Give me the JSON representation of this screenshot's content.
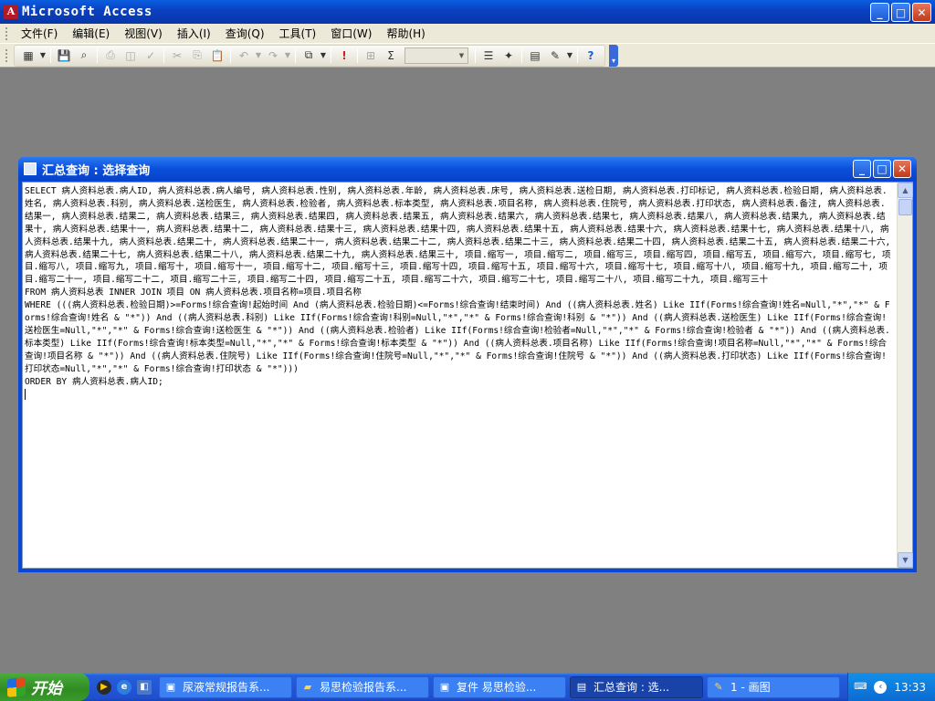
{
  "app": {
    "title": "Microsoft Access",
    "icon": "access-icon",
    "controls": {
      "minimize": "_",
      "maximize": "□",
      "close": "✕"
    }
  },
  "menu": [
    "文件(F)",
    "编辑(E)",
    "视图(V)",
    "插入(I)",
    "查询(Q)",
    "工具(T)",
    "窗口(W)",
    "帮助(H)"
  ],
  "toolbar": {
    "items": [
      "view-icon",
      "save-icon",
      "print-preview-icon",
      "print-icon",
      "spelling-icon",
      "cut-icon",
      "copy-icon",
      "paste-icon",
      "undo-icon",
      "redo-icon",
      "query-type-icon",
      "run-icon",
      "show-table-icon",
      "totals-icon",
      "properties-icon",
      "build-icon",
      "database-window-icon",
      "new-object-icon",
      "help-icon"
    ],
    "run_glyph": "!",
    "totals_glyph": "Σ",
    "help_glyph": "?",
    "zoom_value": ""
  },
  "query_window": {
    "title": "汇总查询 : 选择查询",
    "sql_lines": [
      "SELECT 病人资料总表.病人ID, 病人资料总表.病人编号, 病人资料总表.性别, 病人资料总表.年龄, 病人资料总表.床号, 病人资料总表.送检日期, 病人资料总表.打印标记, 病人资料总表.检验日期, 病人资料总表.姓名, 病人资料总表.科别, 病人资料总表.送检医生, 病人资料总表.检验者, 病人资料总表.标本类型, 病人资料总表.项目名称, 病人资料总表.住院号, 病人资料总表.打印状态, 病人资料总表.备注, 病人资料总表.结果一, 病人资料总表.结果二, 病人资料总表.结果三, 病人资料总表.结果四, 病人资料总表.结果五, 病人资料总表.结果六, 病人资料总表.结果七, 病人资料总表.结果八, 病人资料总表.结果九, 病人资料总表.结果十, 病人资料总表.结果十一, 病人资料总表.结果十二, 病人资料总表.结果十三, 病人资料总表.结果十四, 病人资料总表.结果十五, 病人资料总表.结果十六, 病人资料总表.结果十七, 病人资料总表.结果十八, 病人资料总表.结果十九, 病人资料总表.结果二十, 病人资料总表.结果二十一, 病人资料总表.结果二十二, 病人资料总表.结果二十三, 病人资料总表.结果二十四, 病人资料总表.结果二十五, 病人资料总表.结果二十六, 病人资料总表.结果二十七, 病人资料总表.结果二十八, 病人资料总表.结果二十九, 病人资料总表.结果三十, 项目.缩写一, 项目.缩写二, 项目.缩写三, 项目.缩写四, 项目.缩写五, 项目.缩写六, 项目.缩写七, 项目.缩写八, 项目.缩写九, 项目.缩写十, 项目.缩写十一, 项目.缩写十二, 项目.缩写十三, 项目.缩写十四, 项目.缩写十五, 项目.缩写十六, 项目.缩写十七, 项目.缩写十八, 项目.缩写十九, 项目.缩写二十, 项目.缩写二十一, 项目.缩写二十二, 项目.缩写二十三, 项目.缩写二十四, 项目.缩写二十五, 项目.缩写二十六, 项目.缩写二十七, 项目.缩写二十八, 项目.缩写二十九, 项目.缩写三十",
      "FROM 病人资料总表 INNER JOIN 项目 ON 病人资料总表.项目名称=项目.项目名称",
      "WHERE (((病人资料总表.检验日期)>=Forms!综合查询!起始时间 And (病人资料总表.检验日期)<=Forms!综合查询!结束时间) And ((病人资料总表.姓名) Like IIf(Forms!综合查询!姓名=Null,\"*\",\"*\" & Forms!综合查询!姓名 & \"*\")) And ((病人资料总表.科别) Like IIf(Forms!综合查询!科别=Null,\"*\",\"*\" & Forms!综合查询!科别 & \"*\")) And ((病人资料总表.送检医生) Like IIf(Forms!综合查询!送检医生=Null,\"*\",\"*\" & Forms!综合查询!送检医生 & \"*\")) And ((病人资料总表.检验者) Like IIf(Forms!综合查询!检验者=Null,\"*\",\"*\" & Forms!综合查询!检验者 & \"*\")) And ((病人资料总表.标本类型) Like IIf(Forms!综合查询!标本类型=Null,\"*\",\"*\" & Forms!综合查询!标本类型 & \"*\")) And ((病人资料总表.项目名称) Like IIf(Forms!综合查询!项目名称=Null,\"*\",\"*\" & Forms!综合查询!项目名称 & \"*\")) And ((病人资料总表.住院号) Like IIf(Forms!综合查询!住院号=Null,\"*\",\"*\" & Forms!综合查询!住院号 & \"*\")) And ((病人资料总表.打印状态) Like IIf(Forms!综合查询!打印状态=Null,\"*\",\"*\" & Forms!综合查询!打印状态 & \"*\")))",
      "ORDER BY 病人资料总表.病人ID;"
    ]
  },
  "taskbar": {
    "start_label": "开始",
    "tasks": [
      {
        "label": "尿液常规报告系...",
        "icon": "app-window-icon",
        "active": false
      },
      {
        "label": "易思检验报告系...",
        "icon": "folder-icon",
        "active": false
      },
      {
        "label": "复件 易思检验...",
        "icon": "app-window-icon",
        "active": false
      },
      {
        "label": "汇总查询 : 选...",
        "icon": "query-window-icon",
        "active": true
      },
      {
        "label": "1 - 画图",
        "icon": "paint-icon",
        "active": false
      }
    ],
    "clock": "13:33"
  },
  "colors": {
    "titlebar": "#0a4fdc",
    "desktop": "#808080",
    "chrome": "#ece9d8",
    "start": "#3a9a2c"
  }
}
